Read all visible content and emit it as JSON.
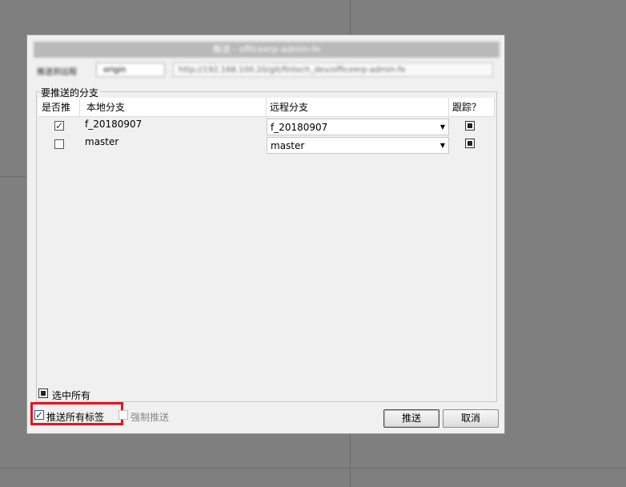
{
  "dialog": {
    "title": "推送 - officeerp-admin-fe",
    "remote_label": "推送到远程",
    "remote_value": "origin",
    "remote_url": "http://192.168.100.20/git/fintech_dev/officeerp-admin-fe"
  },
  "branches": {
    "group_title": "要推送的分支",
    "headers": {
      "push": "是否推",
      "local": "本地分支",
      "remote": "远程分支",
      "track": "跟踪？"
    },
    "rows": [
      {
        "push": true,
        "local": "f_20180907",
        "remote": "f_20180907",
        "track": true
      },
      {
        "push": false,
        "local": "master",
        "remote": "master",
        "track": true
      }
    ]
  },
  "options": {
    "select_all": "选中所有",
    "push_all_tags": "推送所有标签",
    "force_push": "强制推送"
  },
  "buttons": {
    "push": "推送",
    "cancel": "取消"
  },
  "colors": {
    "highlight_box": "#e8121e"
  }
}
